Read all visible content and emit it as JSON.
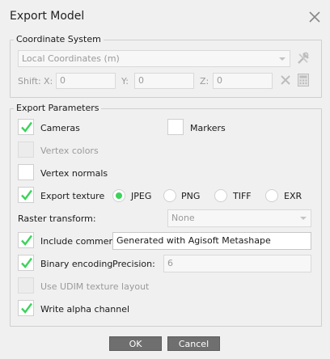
{
  "dialog": {
    "title": "Export Model",
    "close_icon": "close-icon"
  },
  "coordinate_system": {
    "legend": "Coordinate System",
    "crs_value": "Local Coordinates (m)",
    "shift_label": "Shift:",
    "x_label": "X:",
    "x_value": "0",
    "y_label": "Y:",
    "y_value": "0",
    "z_label": "Z:",
    "z_value": "0"
  },
  "export_parameters": {
    "legend": "Export Parameters",
    "cameras": {
      "label": "Cameras",
      "checked": true
    },
    "markers": {
      "label": "Markers",
      "checked": false
    },
    "vertex_colors": {
      "label": "Vertex colors",
      "checked": false,
      "disabled": true
    },
    "vertex_normals": {
      "label": "Vertex normals",
      "checked": false
    },
    "export_texture": {
      "label": "Export texture",
      "checked": true
    },
    "formats": [
      "JPEG",
      "PNG",
      "TIFF",
      "EXR"
    ],
    "selected_format": "JPEG",
    "raster_transform_label": "Raster transform:",
    "raster_transform_value": "None",
    "include_comment": {
      "label": "Include comment",
      "checked": true
    },
    "comment_value": "Generated with Agisoft Metashape",
    "binary_encoding": {
      "label": "Binary encoding",
      "checked": true
    },
    "precision_label": "Precision:",
    "precision_value": "6",
    "udim": {
      "label": "Use UDIM texture layout",
      "checked": false,
      "disabled": true
    },
    "write_alpha": {
      "label": "Write alpha channel",
      "checked": true
    }
  },
  "buttons": {
    "ok": "OK",
    "cancel": "Cancel"
  },
  "colors": {
    "check_green": "#3bd35b",
    "button_bg": "#6f6f6f"
  }
}
